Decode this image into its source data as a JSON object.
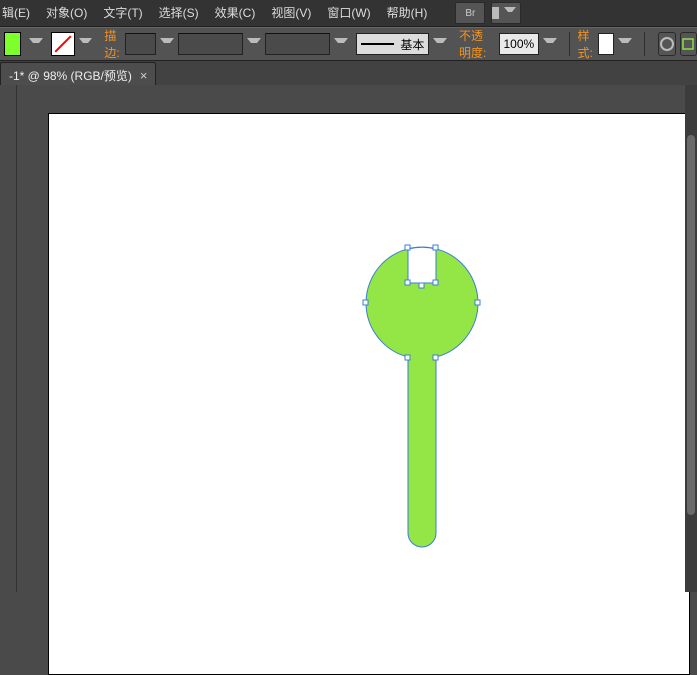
{
  "menu": {
    "items": [
      "辑(E)",
      "对象(O)",
      "文字(T)",
      "选择(S)",
      "效果(C)",
      "视图(V)",
      "窗口(W)",
      "帮助(H)"
    ]
  },
  "toolbar_icon_1": "Br",
  "optbar": {
    "stroke_label": "描边:",
    "stroke_weight": "",
    "preset_label": "基本",
    "opacity_label": "不透明度:",
    "opacity_value": "100%",
    "style_label": "样式:"
  },
  "doctab": {
    "title": "-1* @ 98% (RGB/预览)",
    "close": "×"
  },
  "artwork": {
    "fill": "#94e646",
    "sel_stroke": "#3a7fd6"
  }
}
